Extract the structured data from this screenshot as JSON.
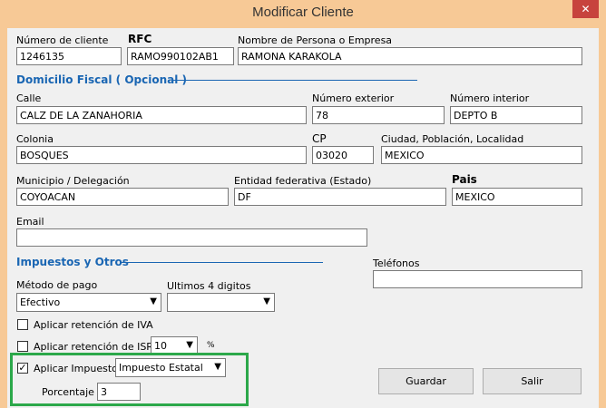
{
  "window": {
    "title": "Modificar Cliente",
    "close_label": "✕"
  },
  "client": {
    "numero_label": "Número de cliente",
    "numero_value": "1246135",
    "rfc_label": "RFC",
    "rfc_value": "RAMO990102AB1",
    "nombre_label": "Nombre de Persona o Empresa",
    "nombre_value": "RAMONA KARAKOLA"
  },
  "domicilio": {
    "section_label": "Domicilio Fiscal  ( Opcional )",
    "calle_label": "Calle",
    "calle_value": "CALZ DE LA ZANAHORIA",
    "num_ext_label": "Número exterior",
    "num_ext_value": "78",
    "num_int_label": "Número interior",
    "num_int_value": "DEPTO B",
    "colonia_label": "Colonia",
    "colonia_value": "BOSQUES",
    "cp_label": "CP",
    "cp_value": "03020",
    "ciudad_label": "Ciudad, Población, Localidad",
    "ciudad_value": "MEXICO",
    "municipio_label": "Municipio / Delegación",
    "municipio_value": "COYOACAN",
    "entidad_label": "Entidad federativa (Estado)",
    "entidad_value": "DF",
    "pais_label": "Pais",
    "pais_value": "MEXICO",
    "email_label": "Email",
    "email_value": ""
  },
  "impuestos": {
    "section_label": "Impuestos y Otros",
    "metodo_label": "Método de pago",
    "metodo_value": "Efectivo",
    "ultimos_label": "Ultimos 4 digitos",
    "ultimos_value": "",
    "iva_label": "Aplicar retención de IVA",
    "iva_checked": false,
    "isr_label": "Aplicar retención de ISR",
    "isr_checked": false,
    "isr_rate_value": "10",
    "isr_percent_symbol": "%",
    "aplicar_label": "Aplicar Impuesto",
    "aplicar_checked": true,
    "impuesto_value": "Impuesto Estatal",
    "porcentaje_label": "Porcentaje",
    "porcentaje_value": "3"
  },
  "telefonos": {
    "label": "Teléfonos",
    "value": ""
  },
  "buttons": {
    "guardar": "Guardar",
    "salir": "Salir"
  },
  "colors": {
    "title_bar": "#f7c996",
    "section_blue": "#1a66b3",
    "close_red": "#c7433d",
    "highlight_green": "#2ca84a"
  },
  "icons": {
    "close": "close-icon",
    "dropdown": "chevron-down-icon",
    "checkmark": "checkmark-icon"
  }
}
